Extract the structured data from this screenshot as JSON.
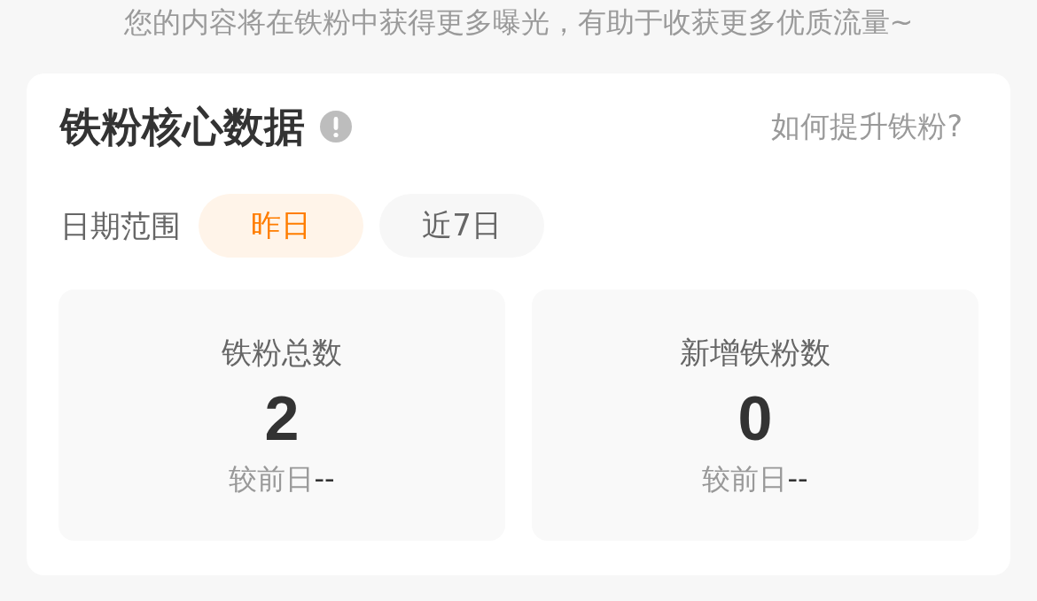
{
  "notice": "您的内容将在铁粉中获得更多曝光，有助于收获更多优质流量~",
  "card": {
    "title": "铁粉核心数据",
    "help_link": "如何提升铁粉?",
    "date_range": {
      "label": "日期范围",
      "options": [
        {
          "label": "昨日",
          "selected": true
        },
        {
          "label": "近7日",
          "selected": false
        }
      ]
    },
    "stats": [
      {
        "label": "铁粉总数",
        "value": "2",
        "compare_label": "较前日",
        "compare_value": "--"
      },
      {
        "label": "新增铁粉数",
        "value": "0",
        "compare_label": "较前日",
        "compare_value": "--"
      }
    ]
  }
}
